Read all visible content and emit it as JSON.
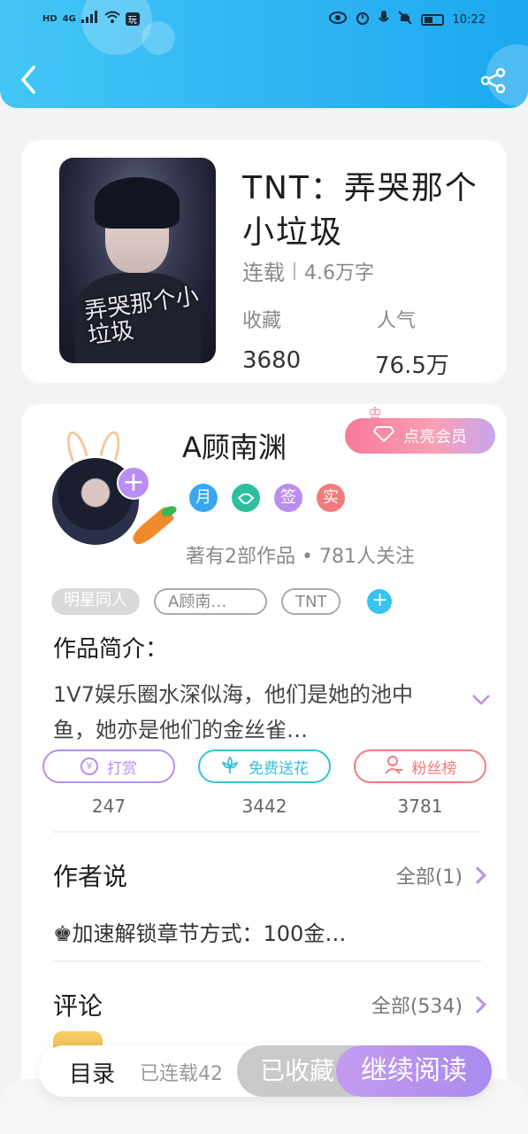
{
  "status_bar": {
    "left_chips": [
      "HD",
      "4G"
    ],
    "app_badge": "玩",
    "time": "10:22"
  },
  "header": {
    "back_icon": "chevron-left-icon",
    "share_icon": "share-icon",
    "bg_color": "#2fb3f2"
  },
  "book": {
    "title": "TNT：弄哭那个小垃圾",
    "cover_title": "弄哭那个小垃圾",
    "status": "连载",
    "word_count": "4.6万字",
    "collect_label": "收藏",
    "collect_value": "3680",
    "popularity_label": "人气",
    "popularity_value": "76.5万"
  },
  "author": {
    "name": "A顾南渊",
    "vip_label": "点亮会员",
    "badges": [
      {
        "text": "月",
        "color": "#3aa6f0"
      },
      {
        "text": "",
        "color": "#2dbf9f"
      },
      {
        "text": "签",
        "color": "#b98ef0"
      },
      {
        "text": "实",
        "color": "#f27a7a"
      }
    ],
    "stats": "著有2部作品 • 781人关注"
  },
  "tags": [
    "明星同人",
    "A顾南…",
    "TNT"
  ],
  "intro": {
    "title": "作品简介：",
    "text": "1V7娱乐圈水深似海，他们是她的池中鱼，她亦是他们的金丝雀…"
  },
  "actions": [
    {
      "label": "打赏",
      "count": "247",
      "color": "#b98ef0",
      "icon": "yen-icon"
    },
    {
      "label": "免费送花",
      "count": "3442",
      "color": "#35c3d8",
      "icon": "flower-icon"
    },
    {
      "label": "粉丝榜",
      "count": "3781",
      "color": "#f27a7a",
      "icon": "user-icon"
    }
  ],
  "author_note": {
    "title": "作者说",
    "more": "全部(1)",
    "text": "♚加速解锁章节方式：100金…"
  },
  "comments": {
    "title": "评论",
    "more": "全部(534)"
  },
  "bottom": {
    "toc": "目录",
    "progress": "已连载42",
    "collected": "已收藏",
    "continue": "继续阅读"
  }
}
